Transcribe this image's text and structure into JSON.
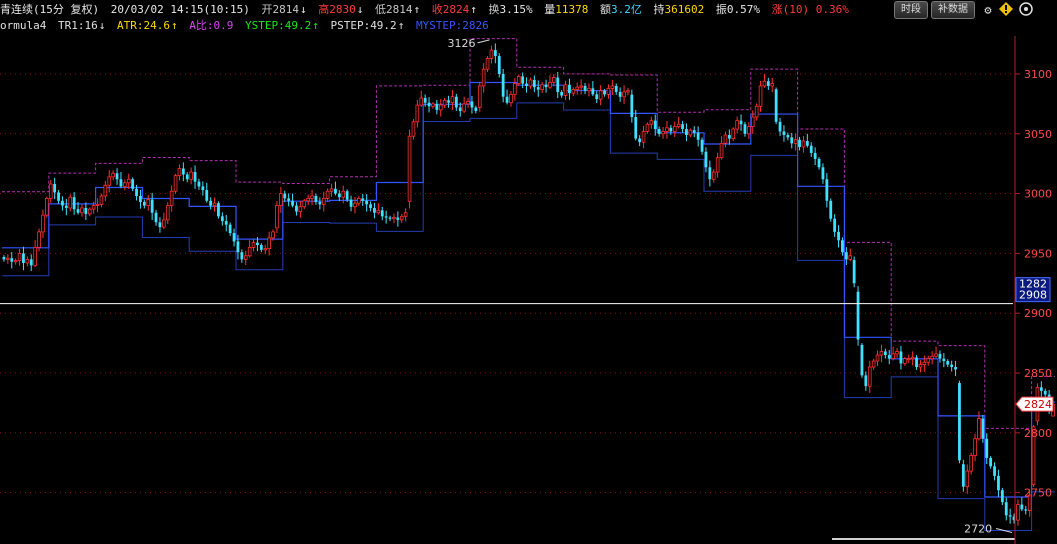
{
  "header": {
    "instrument": "青连续(15分 复权)",
    "datetime": "20/03/02 14:15(10:15)",
    "open_label": "开",
    "open_value": "2814",
    "high_label": "高",
    "high_value": "2830",
    "low_label": "低",
    "low_value": "2814",
    "close_label": "收",
    "close_value": "2824",
    "turnover_label": "换",
    "turnover_value": "3.15%",
    "volume_label": "量",
    "volume_value": "11378",
    "amount_label": "额",
    "amount_value": "3.2亿",
    "oi_label": "持",
    "oi_value": "361602",
    "amplitude_label": "振",
    "amplitude_value": "0.57%",
    "change_label": "涨",
    "change_value": "(10)",
    "change_pct": "0.36%",
    "arrow_up": "↑",
    "arrow_down": "↓"
  },
  "toolbar": {
    "timeshare_label": "时段",
    "supplement_label": "补数据",
    "icons": [
      "gear-icon",
      "warning-icon",
      "circle-icon"
    ]
  },
  "indicator": {
    "name": "ormula4",
    "tr1": "TR1:16",
    "atr": "ATR:24.6",
    "ratio": "A比:0.9",
    "ystep": "YSTEP:49.2",
    "pstep": "PSTEP:49.2",
    "mystep": "MYSTEP:2826",
    "colors": {
      "tr1": "#e0e0e0",
      "atr": "#ffd700",
      "ratio": "#e040fb",
      "ystep": "#19e619",
      "pstep": "#e0e0e0",
      "mystep": "#3355ff"
    }
  },
  "price_axis": {
    "ticks": [
      "3100",
      "3050",
      "3000",
      "2950",
      "2900",
      "2850",
      "2800",
      "2750"
    ],
    "crosshair_top": "1282",
    "crosshair_price": "2908",
    "current_price": "2824"
  },
  "annotations": {
    "high_mark": "3126",
    "low_mark": "2720"
  },
  "chart_data": {
    "type": "candlestick",
    "interval": "15分",
    "ylim": [
      2718,
      3128
    ],
    "y_ticks": [
      2750,
      2800,
      2850,
      2900,
      2950,
      3000,
      3050,
      3100
    ],
    "crosshair_price": 2908,
    "current_price": 2824,
    "marked_high": 3126,
    "marked_low": 2720,
    "last_bar": {
      "open": 2814,
      "high": 2830,
      "low": 2814,
      "close": 2824
    },
    "closes": [
      2945,
      2946,
      2943,
      2944,
      2950,
      2942,
      2945,
      2940,
      2955,
      2968,
      2982,
      2996,
      3008,
      3001,
      2994,
      2990,
      2988,
      2997,
      2987,
      2984,
      2988,
      2983,
      2987,
      2990,
      2991,
      2998,
      3007,
      3014,
      3017,
      3012,
      3006,
      3009,
      3012,
      3004,
      2998,
      2993,
      2990,
      2995,
      2984,
      2976,
      2972,
      2978,
      2990,
      3002,
      3015,
      3021,
      3016,
      3012,
      3018,
      3010,
      3006,
      3003,
      2994,
      2990,
      2992,
      2981,
      2977,
      2974,
      2967,
      2960,
      2951,
      2945,
      2948,
      2955,
      2959,
      2957,
      2953,
      2954,
      2963,
      2968,
      2990,
      3000,
      2996,
      2994,
      2990,
      2985,
      2989,
      2994,
      2996,
      2998,
      2993,
      2991,
      2996,
      3002,
      3004,
      3000,
      2997,
      3002,
      2995,
      2989,
      2992,
      2996,
      2994,
      2991,
      2988,
      2984,
      2986,
      2981,
      2980,
      2979,
      2980,
      2978,
      2981,
      2984,
      3048,
      3060,
      3074,
      3080,
      3076,
      3073,
      3075,
      3070,
      3074,
      3078,
      3076,
      3081,
      3072,
      3069,
      3075,
      3077,
      3072,
      3069,
      3090,
      3104,
      3113,
      3120,
      3115,
      3100,
      3081,
      3076,
      3083,
      3092,
      3098,
      3092,
      3090,
      3095,
      3089,
      3087,
      3091,
      3089,
      3093,
      3097,
      3085,
      3082,
      3091,
      3084,
      3087,
      3089,
      3090,
      3086,
      3088,
      3083,
      3079,
      3086,
      3083,
      3088,
      3090,
      3085,
      3081,
      3085,
      3086,
      3064,
      3046,
      3043,
      3052,
      3058,
      3061,
      3054,
      3050,
      3052,
      3055,
      3052,
      3056,
      3058,
      3054,
      3049,
      3053,
      3051,
      3045,
      3035,
      3022,
      3012,
      3018,
      3030,
      3042,
      3049,
      3046,
      3054,
      3061,
      3058,
      3050,
      3056,
      3064,
      3073,
      3090,
      3094,
      3090,
      3092,
      3060,
      3052,
      3049,
      3047,
      3042,
      3045,
      3039,
      3044,
      3040,
      3034,
      3029,
      3022,
      3012,
      2994,
      2979,
      2968,
      2961,
      2951,
      2945,
      2948,
      2925,
      2878,
      2848,
      2839,
      2855,
      2860,
      2865,
      2868,
      2865,
      2862,
      2866,
      2868,
      2858,
      2862,
      2862,
      2863,
      2855,
      2857,
      2859,
      2862,
      2864,
      2866,
      2862,
      2860,
      2857,
      2855,
      2853,
      2777,
      2755,
      2768,
      2781,
      2795,
      2812,
      2795,
      2779,
      2772,
      2764,
      2752,
      2742,
      2731,
      2730,
      2727,
      2740,
      2736,
      2735,
      2748,
      2805,
      2838,
      2835,
      2832,
      2820,
      2824
    ],
    "overlays": [
      {
        "name": "PSTEP",
        "color": "#3355ff",
        "style": "solid"
      },
      {
        "name": "YSTEP",
        "color": "#b030b0",
        "style": "dashed"
      }
    ]
  }
}
